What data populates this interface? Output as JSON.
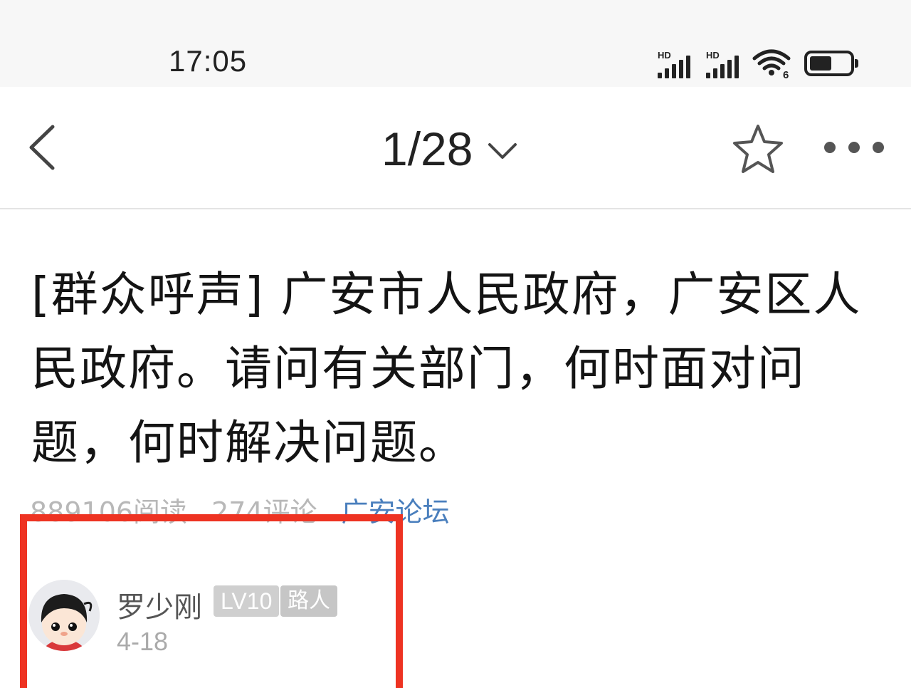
{
  "status_bar": {
    "time": "17:05",
    "signal_1_label": "HD",
    "signal_2_label": "HD",
    "wifi_label": "6",
    "icons": [
      "signal-icon",
      "signal-icon",
      "wifi-icon",
      "battery-icon"
    ]
  },
  "navbar": {
    "page_indicator": "1/28",
    "icons": [
      "back-arrow-icon",
      "chevron-down-icon",
      "star-icon",
      "more-icon"
    ]
  },
  "post": {
    "title": "[群众呼声] 广安市人民政府，广安区人民政府。请问有关部门，何时面对问题，何时解决问题。",
    "reads": "889106阅读",
    "comments": "274评论",
    "forum": "广安论坛"
  },
  "author": {
    "name": "罗少刚",
    "level": "LV10",
    "rank": "路人",
    "date": "4-18"
  },
  "colors": {
    "highlight_border": "#ee3322",
    "forum_link": "#4a7fbd",
    "badge_bg": "#cfcfcf"
  }
}
